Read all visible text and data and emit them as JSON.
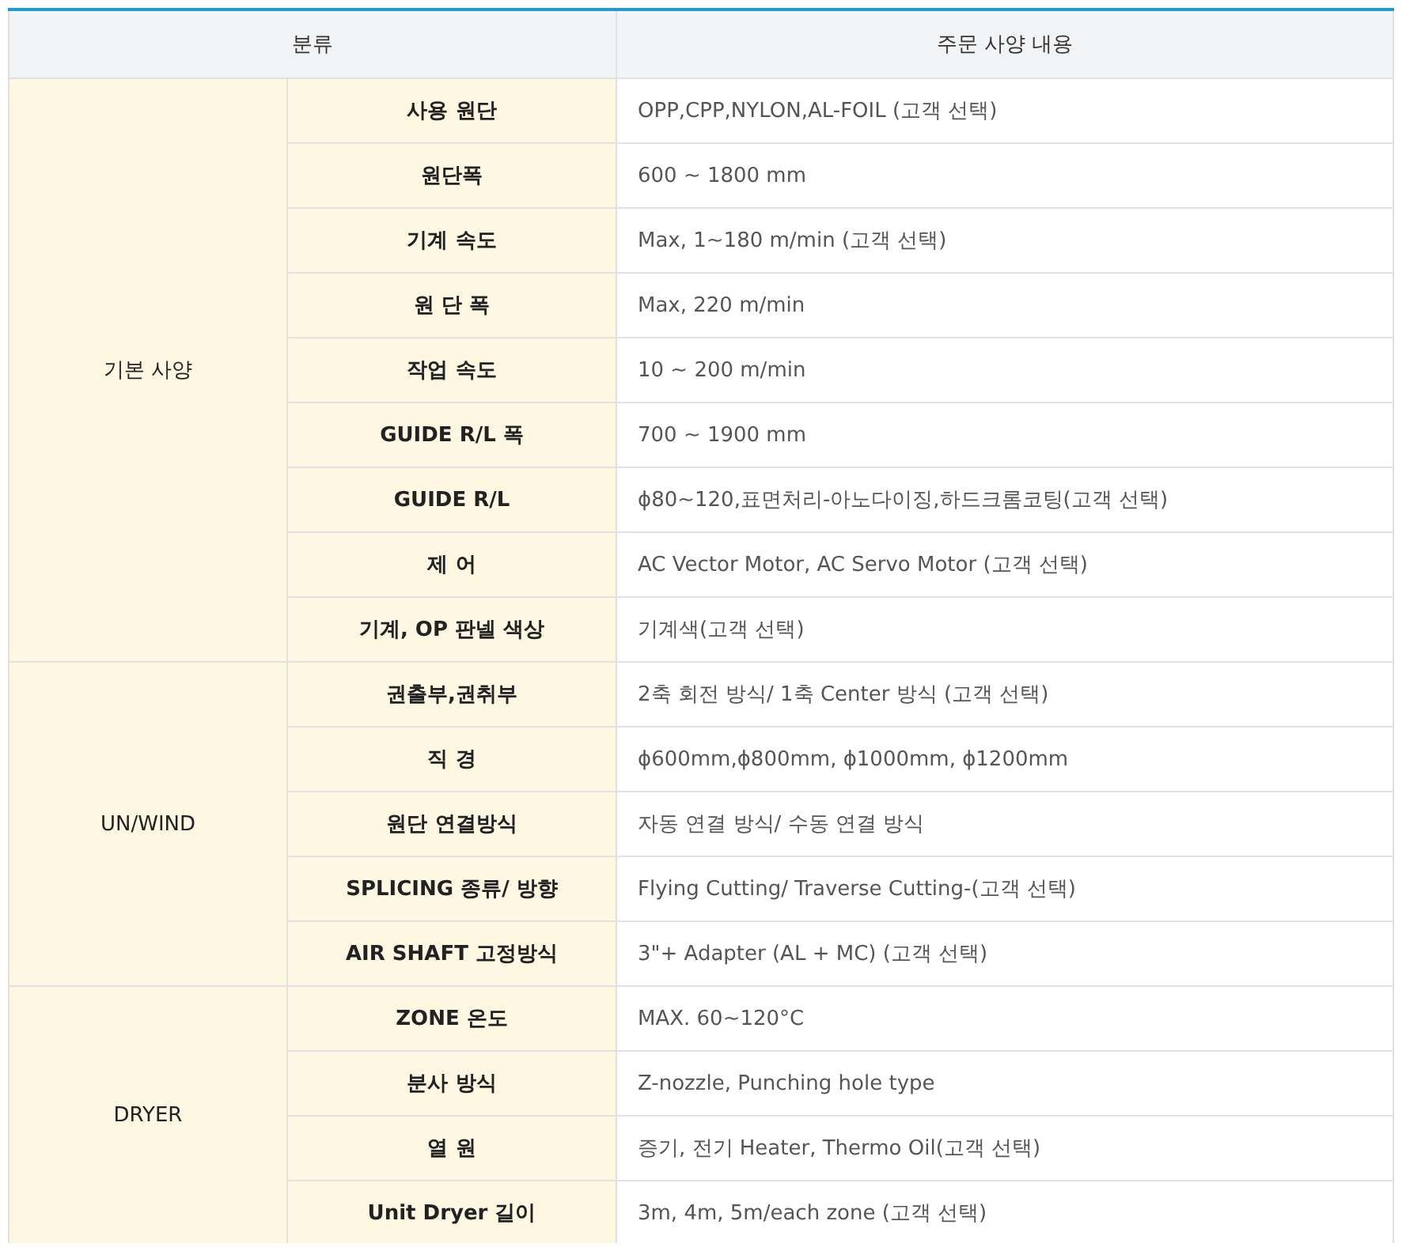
{
  "table": {
    "columns": [
      "분류",
      "주문 사양 내용"
    ],
    "groups": [
      {
        "name": "기본 사양",
        "rows": [
          {
            "label": "사용 원단",
            "value": "OPP,CPP,NYLON,AL-FOIL (고객 선택)"
          },
          {
            "label": "원단폭",
            "value": "600 ~ 1800 mm"
          },
          {
            "label": "기계 속도",
            "value": "Max, 1~180 m/min (고객 선택)"
          },
          {
            "label": "원 단 폭",
            "value": "Max, 220 m/min"
          },
          {
            "label": "작업 속도",
            "value": "10 ~ 200 m/min"
          },
          {
            "label": "GUIDE R/L 폭",
            "value": "700 ~ 1900 mm"
          },
          {
            "label": "GUIDE R/L",
            "value": "ϕ80~120,표면처리-아노다이징,하드크롬코팅(고객 선택)"
          },
          {
            "label": "제 어",
            "value": "AC Vector Motor, AC Servo Motor (고객 선택)"
          },
          {
            "label": "기계, OP 판넬 색상",
            "value": "기계색(고객 선택)"
          }
        ]
      },
      {
        "name": "UN/WIND",
        "rows": [
          {
            "label": "권출부,권취부",
            "value": "2축 회전 방식/ 1축 Center 방식 (고객 선택)"
          },
          {
            "label": "직 경",
            "value": "ϕ600mm,ϕ800mm, ϕ1000mm, ϕ1200mm"
          },
          {
            "label": "원단 연결방식",
            "value": "자동 연결 방식/ 수동 연결 방식"
          },
          {
            "label": "SPLICING 종류/ 방향",
            "value": "Flying Cutting/ Traverse Cutting-(고객 선택)"
          },
          {
            "label": "AIR SHAFT 고정방식",
            "value": "3\"+ Adapter (AL + MC) (고객 선택)"
          }
        ]
      },
      {
        "name": "DRYER",
        "rows": [
          {
            "label": "ZONE 온도",
            "value": "MAX. 60~120°C"
          },
          {
            "label": "분사 방식",
            "value": "Z-nozzle, Punching hole type"
          },
          {
            "label": "열 원",
            "value": "증기, 전기 Heater, Thermo Oil(고객 선택)"
          },
          {
            "label": "Unit Dryer 길이",
            "value": "3m, 4m, 5m/each zone (고객 선택)"
          }
        ]
      }
    ]
  }
}
